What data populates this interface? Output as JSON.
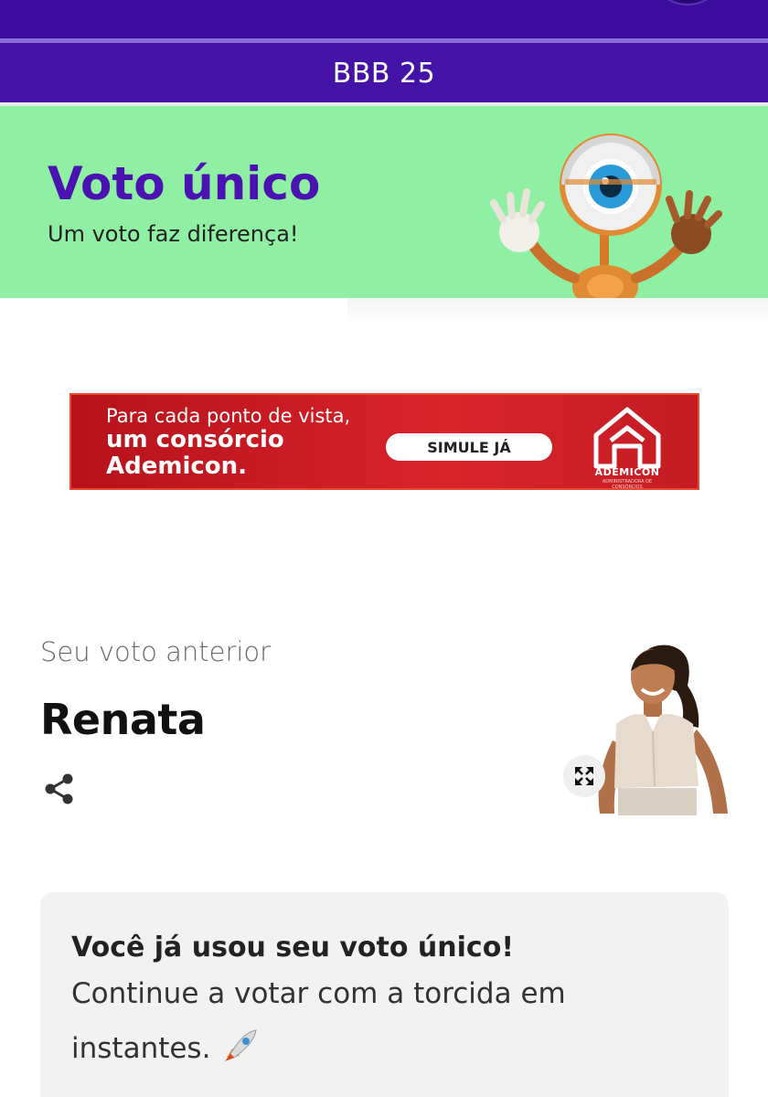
{
  "header": {
    "title": "BBB 25"
  },
  "hero": {
    "title": "Voto único",
    "subtitle": "Um voto faz diferença!",
    "mascot_icon": "big-brother-eye-mascot"
  },
  "ad": {
    "line1": "Para cada ponto de vista,",
    "line2": "um consórcio",
    "line3": "Ademicon.",
    "button_label": "SIMULE JÁ",
    "brand": "ADEMICON",
    "brand_tagline": "ADMINISTRADORA DE CONSÓRCIOS",
    "background_color": "#c41c24"
  },
  "previous_vote": {
    "label": "Seu voto anterior",
    "name": "Renata",
    "share_icon": "share-icon",
    "expand_icon": "expand-icon"
  },
  "notice": {
    "title": "Você já usou seu voto único!",
    "body": "Continue a votar com a torcida em instantes.",
    "emoji": "rocket-icon"
  },
  "colors": {
    "header_purple": "#4513a8",
    "hero_green": "#8ff0a4",
    "title_purple": "#4a12b0"
  }
}
